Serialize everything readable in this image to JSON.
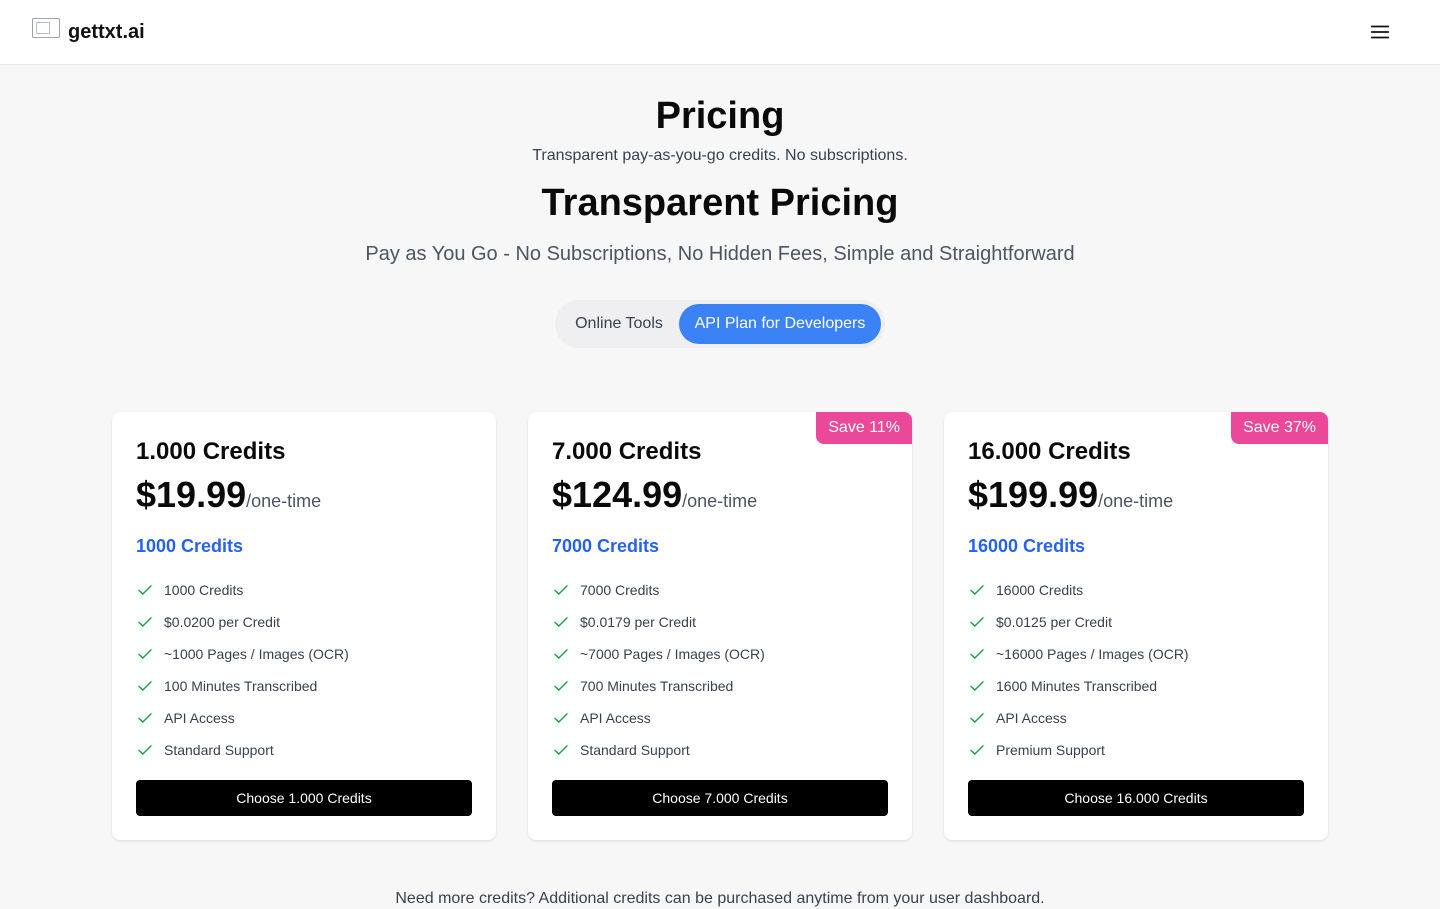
{
  "header": {
    "brand": "gettxt.ai"
  },
  "hero": {
    "title": "Pricing",
    "subtitle": "Transparent pay-as-you-go credits. No subscriptions.",
    "heading": "Transparent Pricing",
    "tagline": "Pay as You Go - No Subscriptions, No Hidden Fees, Simple and Straightforward"
  },
  "toggle": {
    "options": [
      {
        "label": "Online Tools",
        "active": false
      },
      {
        "label": "API Plan for Developers",
        "active": true
      }
    ]
  },
  "colors": {
    "accent": "#3b82f6",
    "badge": "#ec4899",
    "credits_text": "#2563eb",
    "check": "#16a34a",
    "button": "#000000"
  },
  "plans": [
    {
      "title": "1.000 Credits",
      "price": "$19.99",
      "period": "/one-time",
      "credits": "1000 Credits",
      "badge": "",
      "features": [
        "1000 Credits",
        "$0.0200 per Credit",
        "~1000 Pages / Images (OCR)",
        "100 Minutes Transcribed",
        "API Access",
        "Standard Support"
      ],
      "cta": "Choose 1.000 Credits"
    },
    {
      "title": "7.000 Credits",
      "price": "$124.99",
      "period": "/one-time",
      "credits": "7000 Credits",
      "badge": "Save 11%",
      "features": [
        "7000 Credits",
        "$0.0179 per Credit",
        "~7000 Pages / Images (OCR)",
        "700 Minutes Transcribed",
        "API Access",
        "Standard Support"
      ],
      "cta": "Choose 7.000 Credits"
    },
    {
      "title": "16.000 Credits",
      "price": "$199.99",
      "period": "/one-time",
      "credits": "16000 Credits",
      "badge": "Save 37%",
      "features": [
        "16000 Credits",
        "$0.0125 per Credit",
        "~16000 Pages / Images (OCR)",
        "1600 Minutes Transcribed",
        "API Access",
        "Premium Support"
      ],
      "cta": "Choose 16.000 Credits"
    }
  ],
  "footnote": "Need more credits? Additional credits can be purchased anytime from your user dashboard."
}
